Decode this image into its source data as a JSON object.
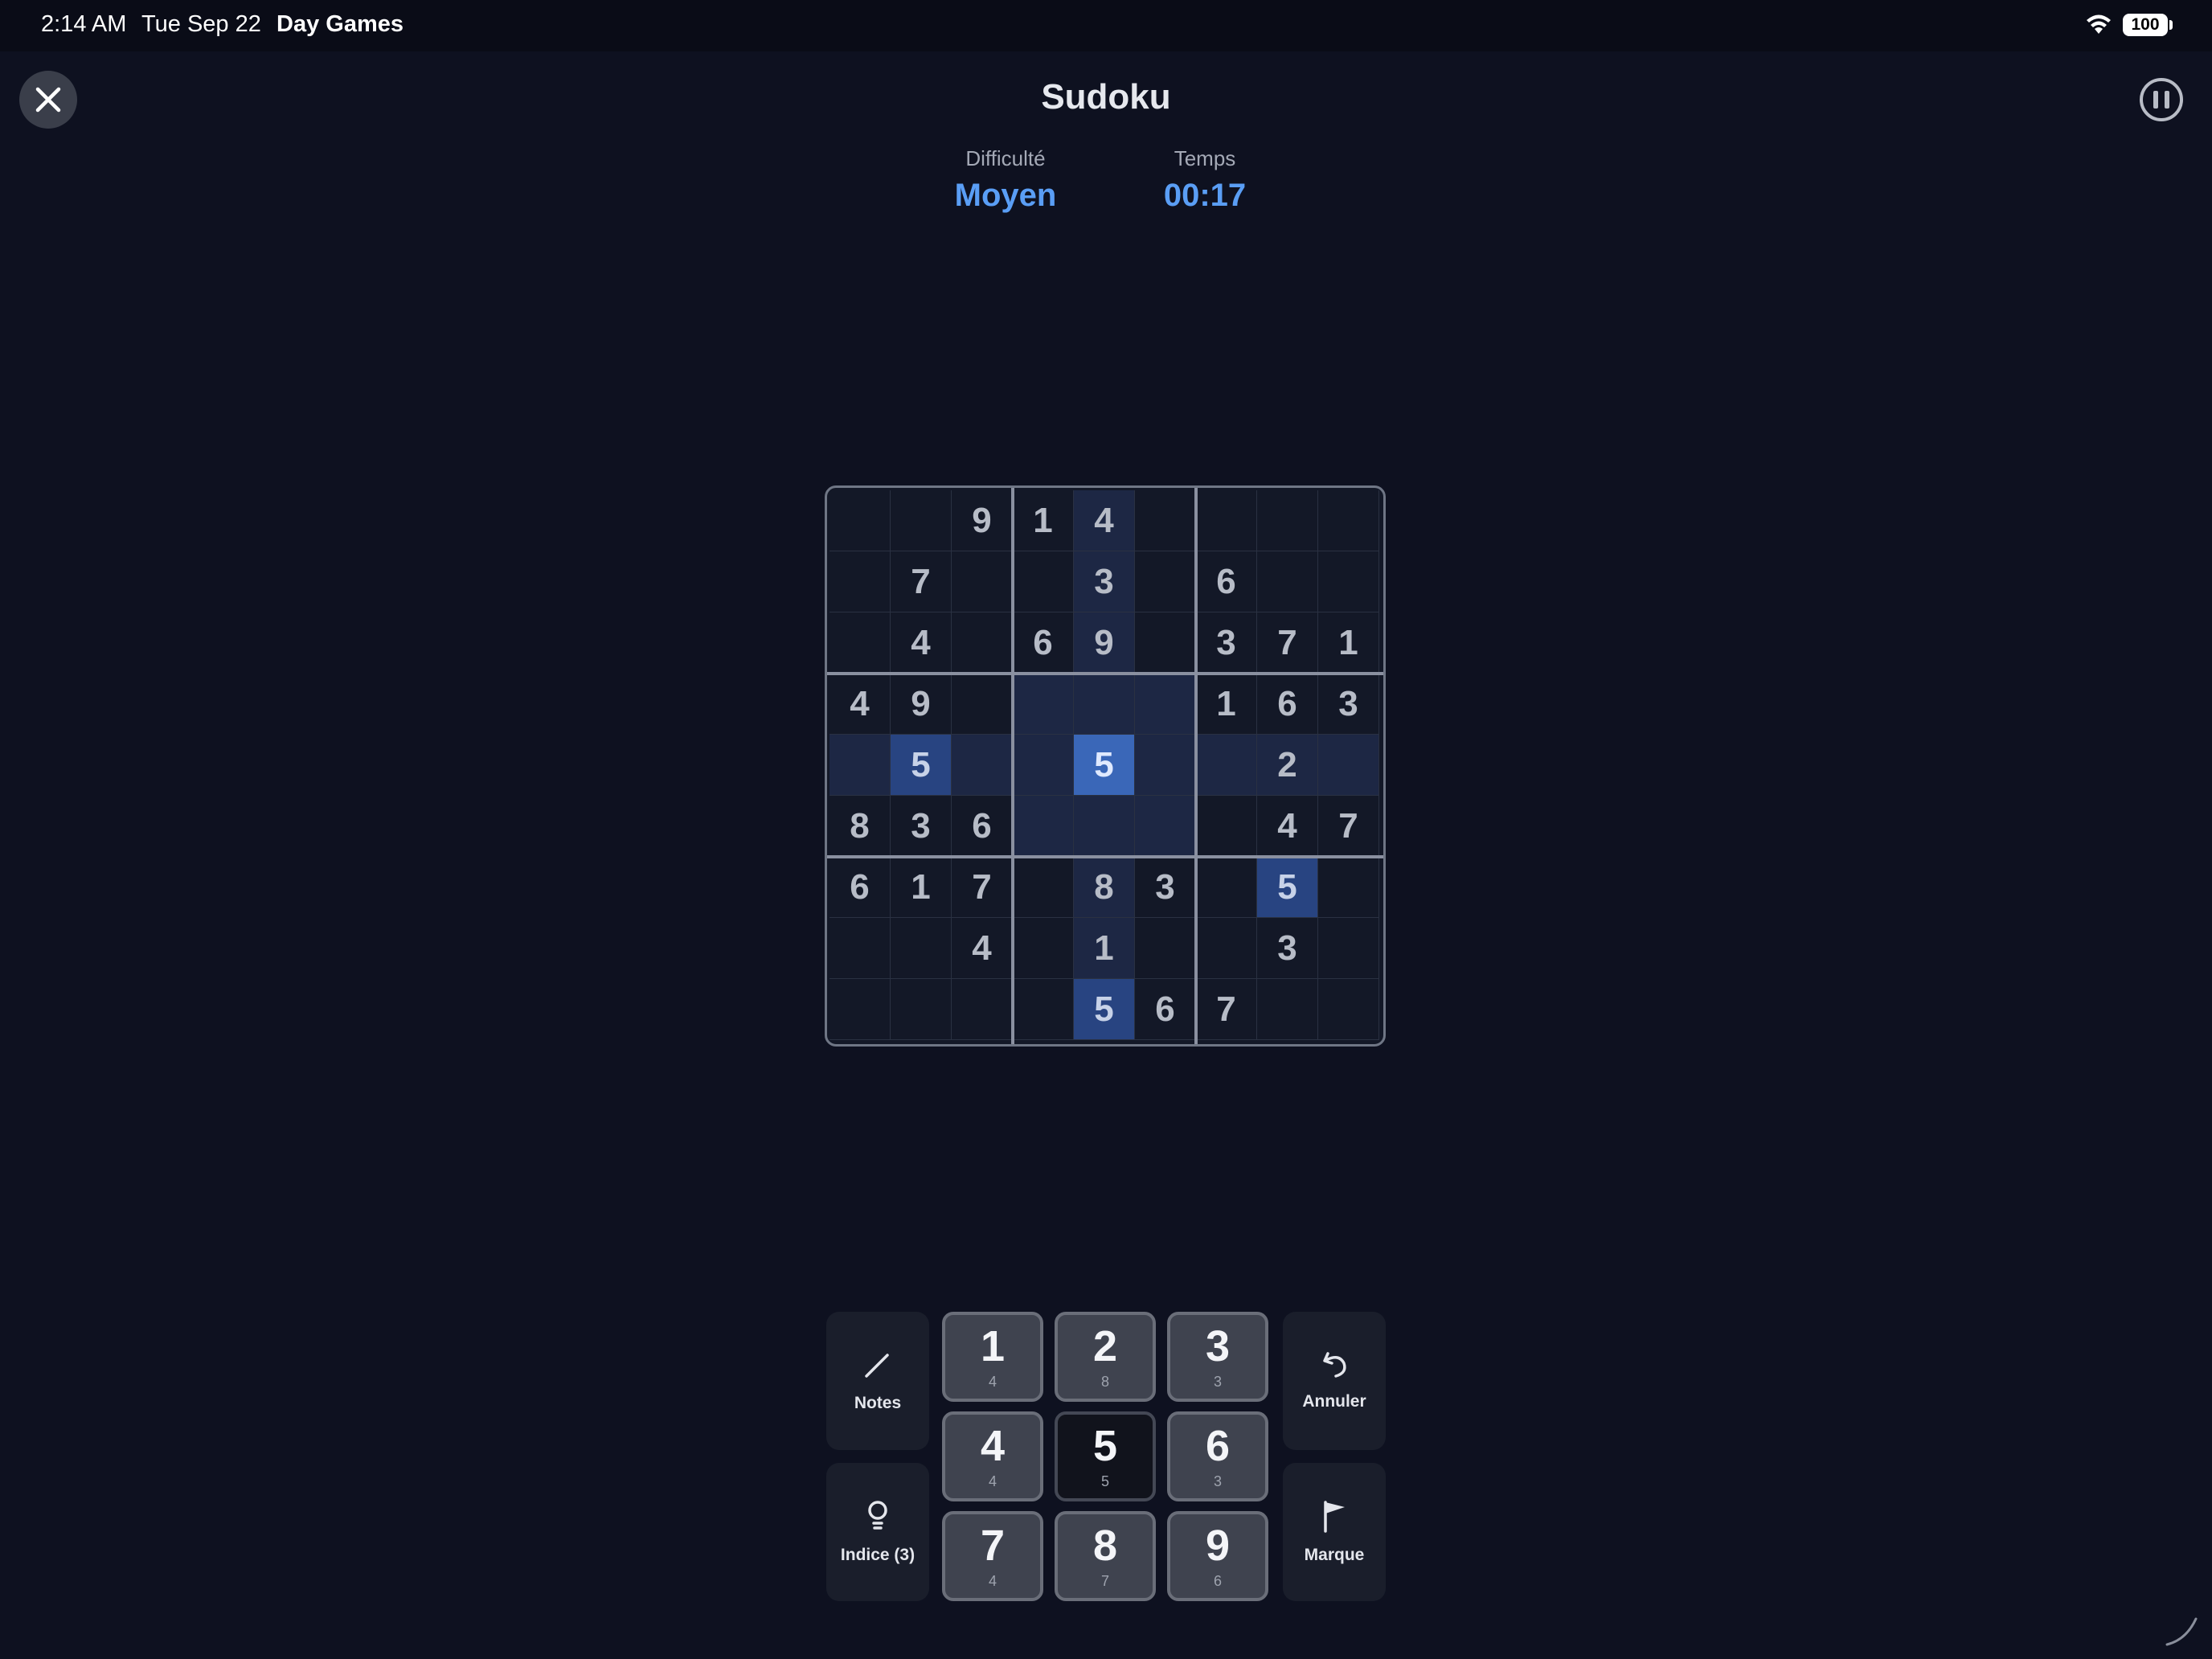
{
  "status_bar": {
    "time": "2:14 AM",
    "date": "Tue Sep 22",
    "app": "Day Games",
    "battery": "100"
  },
  "header": {
    "title": "Sudoku"
  },
  "info": {
    "difficulty_label": "Difficulté",
    "difficulty_value": "Moyen",
    "time_label": "Temps",
    "time_value": "00:17"
  },
  "board": {
    "rows": [
      [
        "",
        "",
        "9",
        "1",
        "4",
        "",
        "",
        "",
        ""
      ],
      [
        "",
        "7",
        "",
        "",
        "3",
        "",
        "6",
        "",
        ""
      ],
      [
        "",
        "4",
        "",
        "6",
        "9",
        "",
        "3",
        "7",
        "1"
      ],
      [
        "4",
        "9",
        "",
        "",
        "",
        "",
        "1",
        "6",
        "3"
      ],
      [
        "",
        "5",
        "",
        "",
        "5",
        "",
        "",
        "2",
        ""
      ],
      [
        "8",
        "3",
        "6",
        "",
        "",
        "",
        "",
        "4",
        "7"
      ],
      [
        "6",
        "1",
        "7",
        "",
        "8",
        "3",
        "",
        "5",
        ""
      ],
      [
        "",
        "",
        "4",
        "",
        "1",
        "",
        "",
        "3",
        ""
      ],
      [
        "",
        "",
        "",
        "",
        "5",
        "6",
        "7",
        "",
        ""
      ]
    ],
    "selected": {
      "row": 4,
      "col": 4
    },
    "highlighted_digit": "5"
  },
  "controls": {
    "notes_label": "Notes",
    "hint_label": "Indice (3)",
    "undo_label": "Annuler",
    "mark_label": "Marque"
  },
  "numpad": [
    {
      "digit": "1",
      "count": "4"
    },
    {
      "digit": "2",
      "count": "8"
    },
    {
      "digit": "3",
      "count": "3"
    },
    {
      "digit": "4",
      "count": "4"
    },
    {
      "digit": "5",
      "count": "5"
    },
    {
      "digit": "6",
      "count": "3"
    },
    {
      "digit": "7",
      "count": "4"
    },
    {
      "digit": "8",
      "count": "7"
    },
    {
      "digit": "9",
      "count": "6"
    }
  ],
  "colors": {
    "accent": "#5a9ef5",
    "background": "#0e1120",
    "selected_cell": "#3a67b8"
  }
}
